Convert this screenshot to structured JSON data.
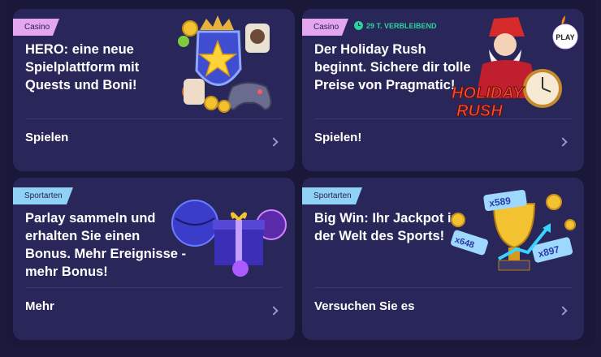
{
  "cards": [
    {
      "category": "Casino",
      "title": "HERO: eine neue Spielplattform mit Quests und Boni!",
      "action": "Spielen",
      "icons": [
        "shield-star-icon",
        "gamepad-icon",
        "coin-icon",
        "crown-icon"
      ]
    },
    {
      "category": "Casino",
      "timer": "29 T. VERBLEIBEND",
      "title": "Der Holiday Rush beginnt. Sichere dir tolle Preise von Pragmatic!",
      "action": "Spielen!",
      "art_text": "HOLIDAY RUSH",
      "badge": "PLAY"
    },
    {
      "category": "Sportarten",
      "title": "Parlay sammeln und erhalten Sie einen Bonus. Mehr Ereignisse - mehr Bonus!",
      "action": "Mehr"
    },
    {
      "category": "Sportarten",
      "title": "Big Win: Ihr Jackpot in der Welt des Sports!",
      "action": "Versuchen Sie es",
      "tickets": [
        "x589",
        "x648",
        "x897"
      ]
    }
  ],
  "colors": {
    "background": "#1c1a3c",
    "card": "#29275a",
    "casino_tag": "#e3a6ef",
    "sport_tag": "#8fd2f6",
    "timer": "#2bd39a"
  }
}
